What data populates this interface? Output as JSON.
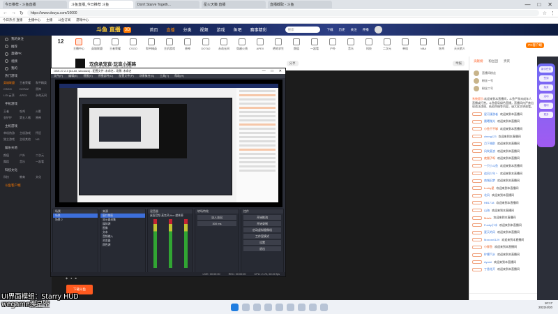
{
  "browser": {
    "tabs": [
      "今日推荐 - 斗鱼直播",
      "斗鱼直播_今日推荐 斗鱼",
      "Don't Starve Togeth...",
      "星火天策 直播",
      "直播截取 - 斗鱼"
    ],
    "url": "https://www.douyu.com/10000",
    "bookmarks": [
      "今日热点 直播",
      "主播中心",
      "主播",
      "斗鱼订阅",
      "游戏中心"
    ]
  },
  "site": {
    "logo": "斗鱼 直播",
    "logo_tag": "3D",
    "nav": [
      "首页",
      "直播",
      "分类",
      "视频",
      "游戏",
      "鱼吧",
      "赛事精彩"
    ],
    "nav_active": "直播",
    "search_placeholder": "搜索",
    "header_icons": [
      "下载",
      "历史",
      "关注",
      "开播"
    ]
  },
  "sidebar": {
    "items": [
      "我的关注",
      "推荐",
      "直播PK",
      "视频",
      "我的"
    ],
    "sections": [
      {
        "title": "热门游戏",
        "cells": [
          "英雄联盟",
          "王者荣耀",
          "和平精英",
          "CSGO",
          "DOTA2",
          "原神",
          "LOL云顶",
          "APEX",
          "永劫无间"
        ]
      },
      {
        "title": "手机游戏",
        "cells": [
          "王者",
          "吃鸡",
          "火影",
          "金铲铲",
          "第五人格",
          "原神"
        ]
      },
      {
        "title": "主机游戏",
        "cells": [
          "单机热游",
          "主机游戏",
          "怀旧",
          "独立游戏",
          "主机其他",
          "NS"
        ]
      },
      {
        "title": "娱乐天地",
        "cells": [
          "颜值",
          "户外",
          "二次元",
          "舞蹈",
          "音乐",
          "一起看"
        ]
      },
      {
        "title": "科技文化",
        "cells": [
          "科技",
          "教育",
          "文化"
        ]
      }
    ],
    "footer": "斗鱼客户端"
  },
  "categories": {
    "count": "12",
    "items": [
      "主播中心",
      "英雄联盟",
      "王者荣耀",
      "CSGO",
      "和平精英",
      "主机游戏",
      "原神",
      "DOTA2",
      "永劫无间",
      "穿越火线",
      "APEX",
      "绝地求生",
      "颜值",
      "一起看",
      "户外",
      "音乐",
      "科技",
      "二次元",
      "单机",
      "NBA",
      "吃鸡",
      "天天狼人"
    ],
    "pc_button": "PC客户端"
  },
  "room": {
    "title": "双倍承宠直·玩直小粥路",
    "subtitle": "直播 · 游戏分区 · 主播 · 斗鱼直播",
    "buttons": [
      "分享",
      "举报"
    ],
    "gift_button": "下载斗鱼"
  },
  "obs": {
    "title": "OBS 27.2.3 (64-bit, windows) - 配置文件: 未命名 - 场景: 未命名",
    "menu": [
      "文件(F)",
      "编辑(E)",
      "视图(V)",
      "停靠部件(D)",
      "配置文件(P)",
      "场景集合(S)",
      "工具(T)",
      "帮助(H)"
    ],
    "docks": {
      "scenes_title": "场景",
      "scenes": [
        "场景",
        "场景 2"
      ],
      "sources_title": "来源",
      "sources": [
        "窗口捕获",
        "显示器采集",
        "媒体源",
        "图像",
        "文本",
        "音频输入",
        "浏览器",
        "颜色源"
      ],
      "mixer_title": "混音器",
      "mixer_channels": [
        "桌面音频",
        "麦克风/Aux",
        "媒体源"
      ],
      "transition_title": "转场特效",
      "transition": "淡入淡出",
      "duration": "300 ms",
      "controls_title": "控件",
      "controls": [
        "开始推流",
        "开始录制",
        "启动虚拟摄像机",
        "工作室模式",
        "设置",
        "退出"
      ]
    },
    "status": [
      "LIVE: 00:00:00",
      "REC: 00:00:00",
      "CPU: 2.1%, 60.00 fps"
    ]
  },
  "chat": {
    "tabs": [
      "贡献榜",
      "粉丝团",
      "贵宾"
    ],
    "tab_active": "贡献榜",
    "fans": [
      "直播间粉丝",
      "粉丝一号",
      "粉丝二号"
    ],
    "notice_label": "系统提示:",
    "notice": "欢迎来到本直播间，斗鱼严禁未成年人直播或打赏。斗鱼倡导绿色直播，直播间内严禁出现违法违规、低俗色情等内容，请大家文明观看。",
    "messages": [
      {
        "name": "星河漫游者",
        "text": "欢迎来到本直播间"
      },
      {
        "name": "晨曦微光",
        "text": "欢迎来到本直播间"
      },
      {
        "name": "小鱼干不够",
        "text": "欢迎来到本直播间"
      },
      {
        "name": "cheng123",
        "text": "欢迎来到本直播间"
      },
      {
        "name": "月下独酌",
        "text": "欢迎来到本直播间"
      },
      {
        "name": "风吹麦浪",
        "text": "欢迎来到本直播间"
      },
      {
        "name": "夜猫子呀",
        "text": "欢迎来到本直播间"
      },
      {
        "name": "一只小斗鱼",
        "text": "欢迎来到本直播间"
      },
      {
        "name": "追风少年丶",
        "text": "欢迎来到本直播间"
      },
      {
        "name": "南城旧梦",
        "text": "欢迎来到本直播间"
      },
      {
        "name": "Lucky星",
        "text": "欢迎来到本直播间"
      },
      {
        "name": "北风",
        "text": "欢迎来到本直播间"
      },
      {
        "name": "HB1718",
        "text": "欢迎来到本直播间"
      },
      {
        "name": "山海",
        "text": "欢迎来到本直播间"
      },
      {
        "name": "Mavis",
        "text": "欢迎来到本直播间"
      },
      {
        "name": "Funky小冰",
        "text": "欢迎来到本直播间"
      },
      {
        "name": "夏天的风",
        "text": "欢迎来到本直播间"
      },
      {
        "name": "Mxxxxx0129",
        "text": "欢迎来到本直播间"
      },
      {
        "name": "小胖鱼",
        "text": "欢迎来到本直播间"
      },
      {
        "name": "柠檬汽水",
        "text": "欢迎来到本直播间"
      },
      {
        "name": "Ayumi",
        "text": "欢迎来到本直播间"
      },
      {
        "name": "丁香花开",
        "text": "欢迎来到本直播间"
      }
    ]
  },
  "floatbar": [
    "新手任务",
    "签到",
    "抽奖",
    "活动",
    "福利",
    "更多"
  ],
  "overlay": {
    "line1": "UI界面模组：Starry HUD",
    "line2": "wegame搜星空"
  },
  "clock": {
    "time": "10:17",
    "date": "2022/4/20"
  },
  "colors": {
    "accent": "#ff5d23",
    "header_bg": "#1c2c64",
    "sidebar_bg": "#25262b"
  }
}
